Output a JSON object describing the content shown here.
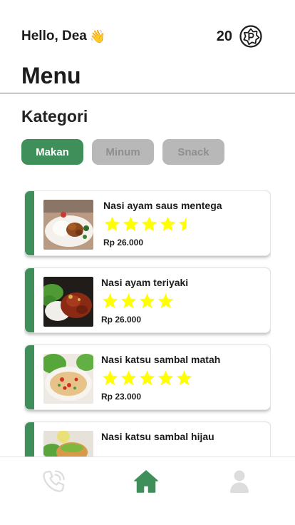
{
  "header": {
    "greeting": "Hello, Dea",
    "greeting_emoji": "👋",
    "points": "20",
    "points_icon": "points-badge-icon"
  },
  "page_title": "Menu",
  "categories": {
    "title": "Kategori",
    "items": [
      "Makan",
      "Minum",
      "Snack"
    ],
    "active": "Makan"
  },
  "menu_items": [
    {
      "name": "Nasi ayam saus mentega",
      "rating": 4.5,
      "price": "Rp 26.000"
    },
    {
      "name": "Nasi ayam teriyaki",
      "rating": 4,
      "price": "Rp 26.000"
    },
    {
      "name": "Nasi katsu sambal matah",
      "rating": 5,
      "price": "Rp 23.000"
    },
    {
      "name": "Nasi katsu sambal hijau",
      "rating": null,
      "price": ""
    }
  ],
  "bottom_nav": {
    "items": [
      "phone-icon",
      "home-icon",
      "profile-icon"
    ],
    "active": "home-icon"
  },
  "colors": {
    "accent": "#3f8f5a",
    "star": "#ffff00",
    "chip_inactive": "#b8b8b8",
    "nav_inactive": "#dddddd"
  }
}
